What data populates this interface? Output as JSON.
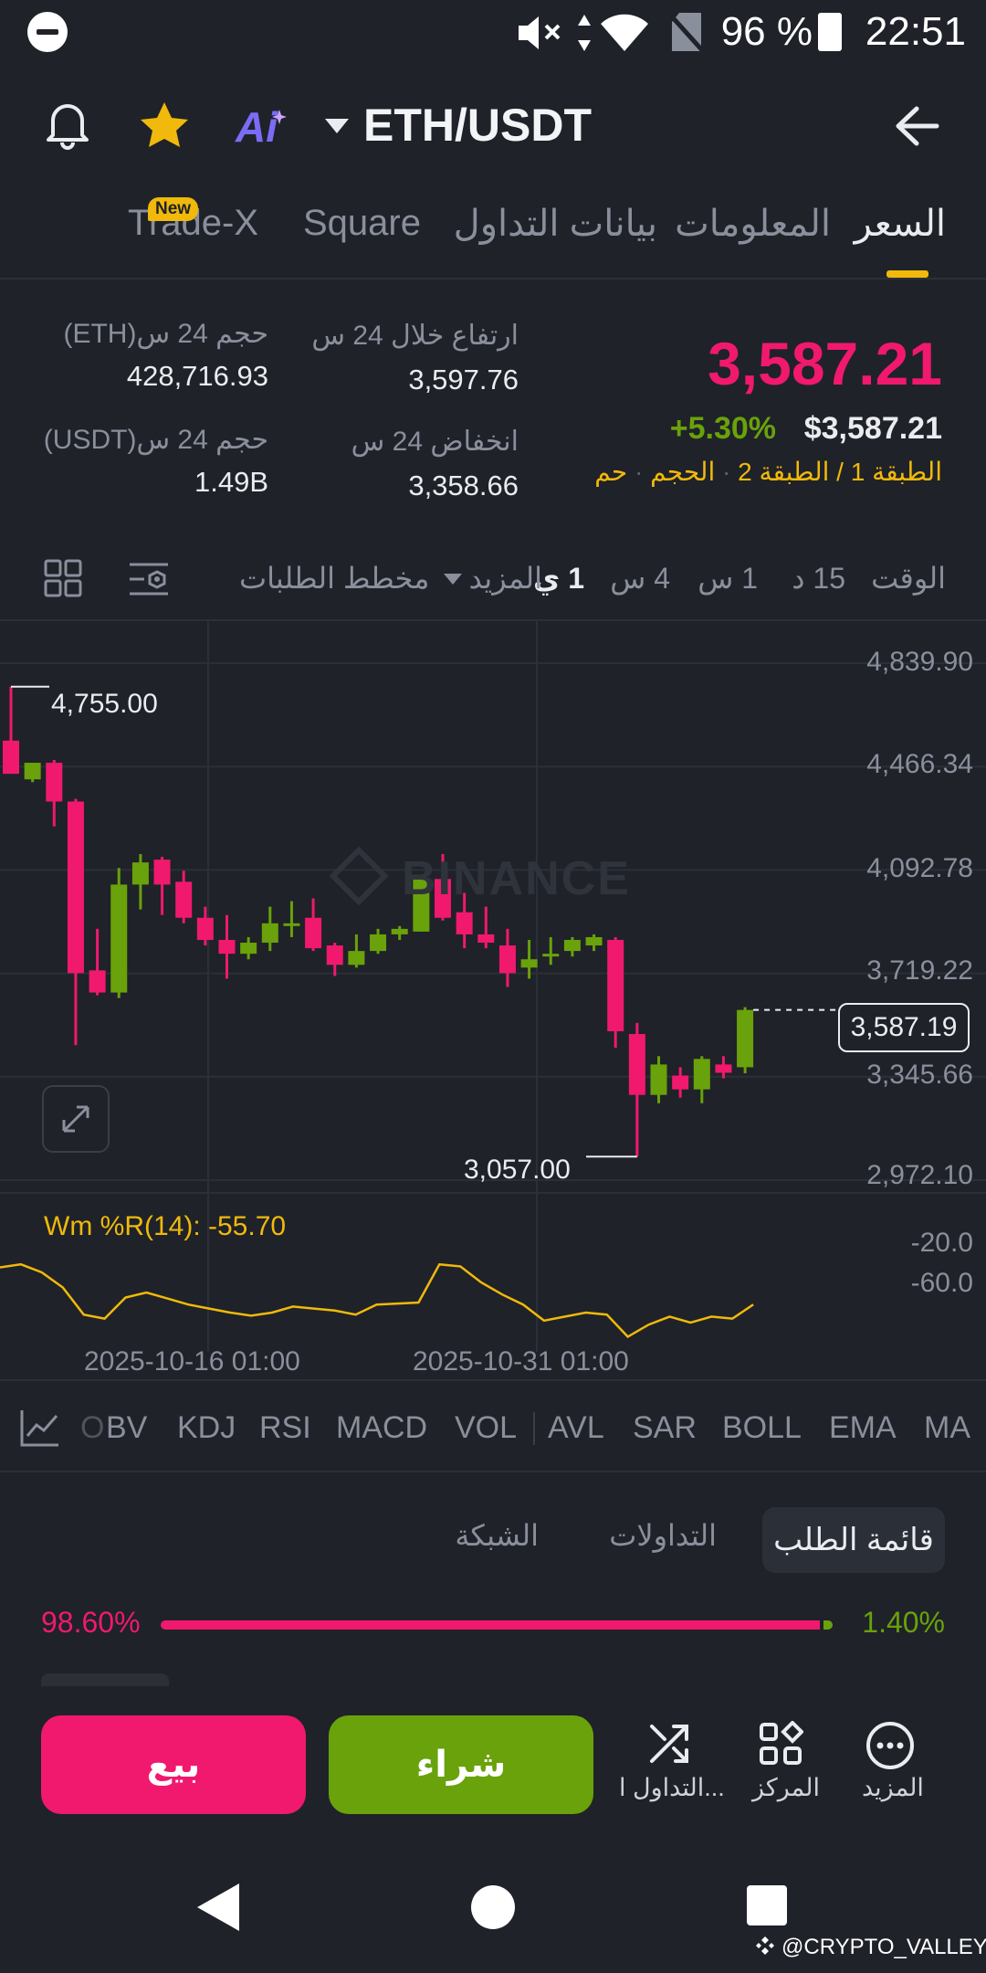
{
  "status_bar": {
    "battery": "96 %",
    "time": "22:51"
  },
  "header": {
    "ai_label": "Ai",
    "pair": "ETH/USDT"
  },
  "tabs": [
    {
      "label": "السعر"
    },
    {
      "label": "المعلومات"
    },
    {
      "label": "بيانات التداول"
    },
    {
      "label": "Square"
    },
    {
      "label": "Trade-X",
      "badge": "New"
    }
  ],
  "price": {
    "last": "3,587.21",
    "change": "+5.30%",
    "usd": "$3,587.21",
    "tags": [
      "الطبقة 1",
      "/",
      "الطبقة 2",
      "الحجم",
      "حم"
    ]
  },
  "stats": {
    "high_label": "ارتفاع خلال 24 س",
    "high_value": "3,597.76",
    "low_label": "انخفاض 24 س",
    "low_value": "3,358.66",
    "vol_eth_label": "حجم 24 س(ETH)",
    "vol_eth_value": "428,716.93",
    "vol_usdt_label": "حجم 24 س(USDT)",
    "vol_usdt_value": "1.49B"
  },
  "intervals": {
    "label": "الوقت",
    "items": [
      "15 د",
      "1 س",
      "4 س",
      "1 ي"
    ],
    "active": "1 ي",
    "more": "المزيد",
    "depth": "مخطط الطلبات"
  },
  "chart_data": {
    "type": "candlestick",
    "y_axis_labels": [
      "4,839.90",
      "4,466.34",
      "4,092.78",
      "3,719.22",
      "3,345.66",
      "2,972.10"
    ],
    "ylim": [
      2972.1,
      4839.9
    ],
    "high_marker": "4,755.00",
    "low_marker": "3,057.00",
    "last_price_tag": "3,587.19",
    "watermark": "BINANCE",
    "x_labels": [
      "2025-10-16 01:00",
      "2025-10-31 01:00"
    ],
    "up_color": "#69a20a",
    "down_color": "#f0196e",
    "candles": [
      {
        "o": 4560,
        "h": 4755,
        "l": 4450,
        "c": 4440
      },
      {
        "o": 4420,
        "h": 4450,
        "l": 4410,
        "c": 4480
      },
      {
        "o": 4480,
        "h": 4490,
        "l": 4250,
        "c": 4340
      },
      {
        "o": 4340,
        "h": 4350,
        "l": 3460,
        "c": 3720
      },
      {
        "o": 3730,
        "h": 3880,
        "l": 3640,
        "c": 3650
      },
      {
        "o": 3650,
        "h": 4100,
        "l": 3630,
        "c": 4040
      },
      {
        "o": 4040,
        "h": 4150,
        "l": 3950,
        "c": 4120
      },
      {
        "o": 4130,
        "h": 4140,
        "l": 3930,
        "c": 4040
      },
      {
        "o": 4050,
        "h": 4090,
        "l": 3900,
        "c": 3920
      },
      {
        "o": 3920,
        "h": 3960,
        "l": 3820,
        "c": 3840
      },
      {
        "o": 3840,
        "h": 3930,
        "l": 3700,
        "c": 3790
      },
      {
        "o": 3790,
        "h": 3850,
        "l": 3770,
        "c": 3830
      },
      {
        "o": 3830,
        "h": 3960,
        "l": 3800,
        "c": 3900
      },
      {
        "o": 3900,
        "h": 3980,
        "l": 3850,
        "c": 3900
      },
      {
        "o": 3920,
        "h": 3990,
        "l": 3800,
        "c": 3810
      },
      {
        "o": 3820,
        "h": 3830,
        "l": 3710,
        "c": 3750
      },
      {
        "o": 3750,
        "h": 3860,
        "l": 3740,
        "c": 3800
      },
      {
        "o": 3800,
        "h": 3880,
        "l": 3790,
        "c": 3860
      },
      {
        "o": 3860,
        "h": 3890,
        "l": 3840,
        "c": 3880
      },
      {
        "o": 3870,
        "h": 4070,
        "l": 3870,
        "c": 4060
      },
      {
        "o": 4060,
        "h": 4150,
        "l": 3910,
        "c": 3920
      },
      {
        "o": 3940,
        "h": 4010,
        "l": 3810,
        "c": 3860
      },
      {
        "o": 3860,
        "h": 3960,
        "l": 3810,
        "c": 3830
      },
      {
        "o": 3820,
        "h": 3880,
        "l": 3670,
        "c": 3720
      },
      {
        "o": 3740,
        "h": 3840,
        "l": 3700,
        "c": 3770
      },
      {
        "o": 3780,
        "h": 3850,
        "l": 3750,
        "c": 3790
      },
      {
        "o": 3800,
        "h": 3850,
        "l": 3780,
        "c": 3840
      },
      {
        "o": 3820,
        "h": 3860,
        "l": 3800,
        "c": 3850
      },
      {
        "o": 3840,
        "h": 3850,
        "l": 3450,
        "c": 3510
      },
      {
        "o": 3500,
        "h": 3540,
        "l": 3057,
        "c": 3280
      },
      {
        "o": 3280,
        "h": 3420,
        "l": 3250,
        "c": 3390
      },
      {
        "o": 3350,
        "h": 3380,
        "l": 3270,
        "c": 3300
      },
      {
        "o": 3300,
        "h": 3420,
        "l": 3250,
        "c": 3410
      },
      {
        "o": 3390,
        "h": 3420,
        "l": 3340,
        "c": 3360
      },
      {
        "o": 3380,
        "h": 3597,
        "l": 3358,
        "c": 3587
      }
    ],
    "indicator": {
      "label": "Wm %R(14): -55.70",
      "y_labels": [
        "-20.0",
        "-60.0"
      ],
      "ylim": [
        -100,
        0
      ],
      "values": [
        -25,
        -22,
        -30,
        -45,
        -72,
        -76,
        -55,
        -50,
        -56,
        -62,
        -66,
        -70,
        -73,
        -70,
        -64,
        -66,
        -68,
        -72,
        -62,
        -61,
        -60,
        -22,
        -24,
        -40,
        -52,
        -62,
        -78,
        -74,
        -70,
        -72,
        -94,
        -82,
        -74,
        -80,
        -74,
        -76,
        -62
      ]
    }
  },
  "indicators": [
    "MA",
    "EMA",
    "BOLL",
    "SAR",
    "AVL",
    "VOL",
    "MACD",
    "RSI",
    "KDJ",
    "BV",
    "O"
  ],
  "orderbook": {
    "tabs": [
      "قائمة الطلب",
      "التداولات",
      "الشبكة"
    ],
    "bid_pct": "1.40%",
    "ask_pct": "98.60%",
    "bid_ratio": 0.014
  },
  "bottom": {
    "more": "المزيد",
    "center": "المركز",
    "trade": "التداول ا...",
    "buy": "شراء",
    "sell": "بيع"
  },
  "watermark": "@CRYPTO_VALLEY"
}
